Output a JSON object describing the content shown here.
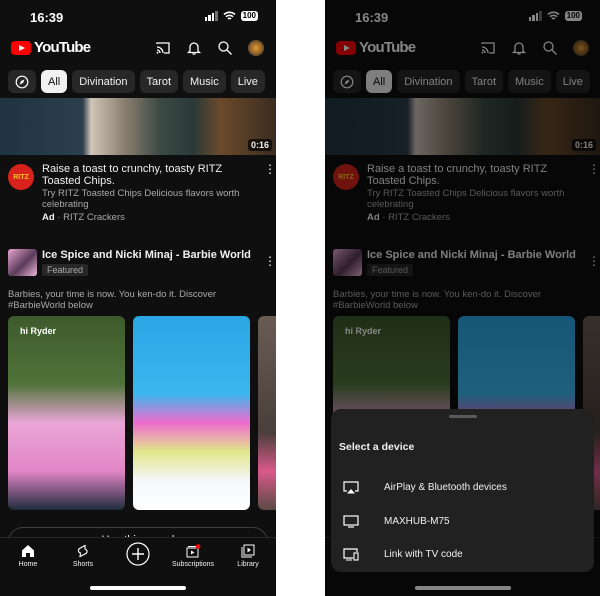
{
  "status": {
    "time": "16:39",
    "battery": "100"
  },
  "header": {
    "logo": "YouTube",
    "icons": [
      "cast-icon",
      "bell-icon",
      "search-icon",
      "avatar"
    ]
  },
  "chips": {
    "explore_icon": "compass-icon",
    "items": [
      "All",
      "Divination",
      "Tarot",
      "Music",
      "Live"
    ],
    "active": "All"
  },
  "ad": {
    "duration": "0:16",
    "logo": "RITZ",
    "title": "Raise a toast to crunchy, toasty RITZ Toasted Chips.",
    "description": "Try RITZ Toasted Chips Delicious flavors worth celebrating",
    "ad_label": "Ad",
    "separator": "·",
    "advertiser": "RITZ Crackers"
  },
  "featured": {
    "title": "Ice Spice and Nicki Minaj - Barbie World (...",
    "badge": "Featured",
    "description": "Barbies, your time is now. You ken-do it. Discover #BarbieWorld below",
    "shorts": [
      {
        "label": "hi Ryder"
      },
      {
        "label": ""
      },
      {
        "label": ""
      }
    ],
    "sound_button": "Use this sound"
  },
  "nav": {
    "items": [
      "Home",
      "Shorts",
      "",
      "Subscriptions",
      "Library"
    ]
  },
  "cast_sheet": {
    "title": "Select a device",
    "devices": [
      {
        "label": "AirPlay & Bluetooth devices",
        "icon": "airplay-icon"
      },
      {
        "label": "MAXHUB-M75",
        "icon": "tv-icon"
      },
      {
        "label": "Link with TV code",
        "icon": "tv-code-icon"
      }
    ]
  },
  "colors": {
    "background": "#0f0f0f",
    "brand_red": "#ff0000",
    "chip": "#272727",
    "sheet": "#212121"
  }
}
